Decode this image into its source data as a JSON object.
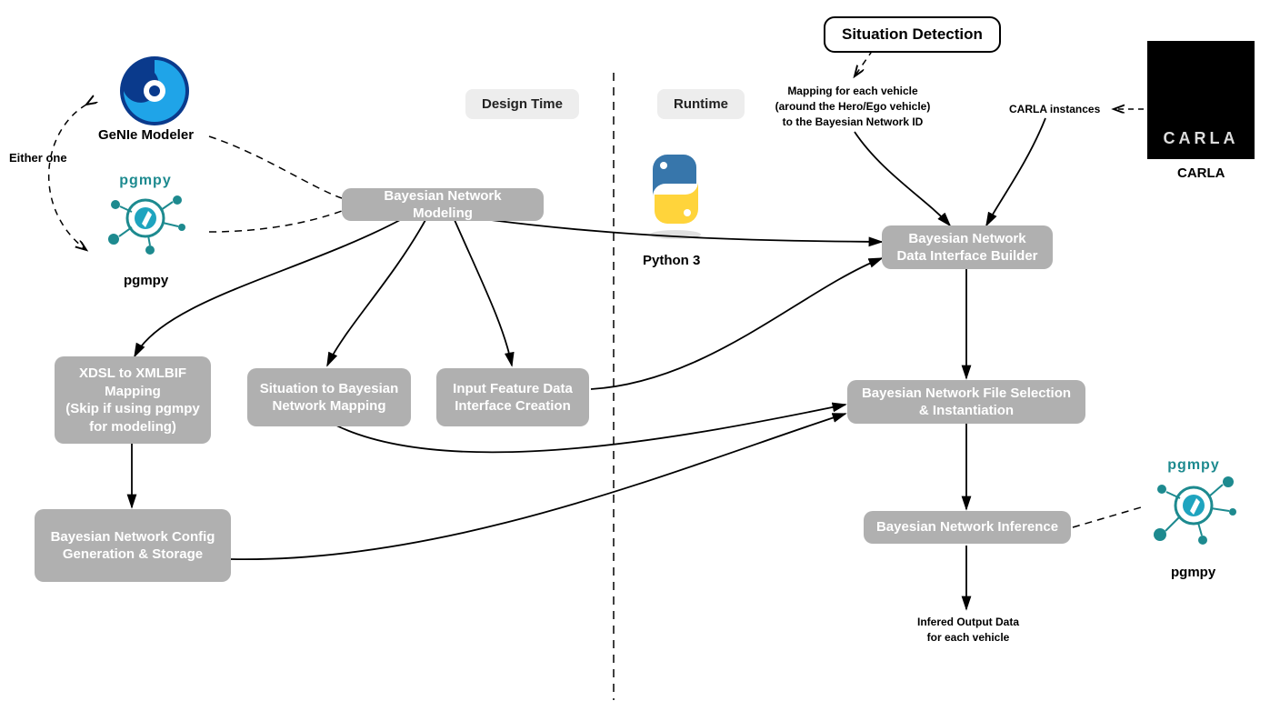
{
  "labels": {
    "designTime": "Design Time",
    "runtime": "Runtime",
    "eitherOne": "Either one",
    "genie": "GeNIe Modeler",
    "pgmpy1": "pgmpy",
    "pgmpy2": "pgmpy",
    "python": "Python 3",
    "carla": "CARLA",
    "carlaBadge": "CARLA",
    "situationDetection": "Situation Detection",
    "mapping": "Mapping for each vehicle\n(around the Hero/Ego vehicle)\nto the Bayesian Network ID",
    "carlaInstances": "CARLA instances",
    "inferedOutput": "Infered Output Data\nfor each vehicle",
    "pgmpyWord": "pgmpy"
  },
  "nodes": {
    "bnm": "Bayesian Network Modeling",
    "xdsl": "XDSL to XMLBIF Mapping\n(Skip if using pgmpy for modeling)",
    "s2bn": "Situation to Bayesian Network Mapping",
    "ifdc": "Input Feature Data Interface Creation",
    "cfg": "Bayesian Network Config Generation & Storage",
    "bdi": "Bayesian Network Data Interface Builder",
    "fsel": "Bayesian Network File Selection & Instantiation",
    "infer": "Bayesian Network Inference"
  }
}
